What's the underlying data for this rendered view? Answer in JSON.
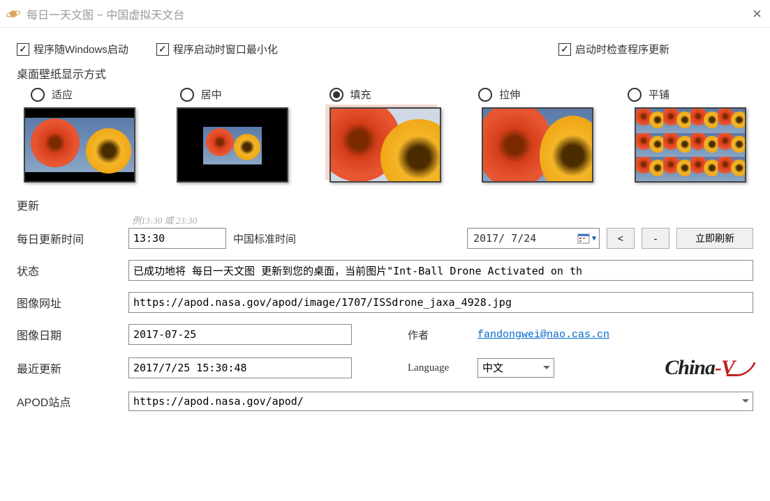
{
  "window": {
    "title": "每日一天文图 ~ 中国虚拟天文台"
  },
  "checkboxes": {
    "startup": {
      "label": "程序随Windows启动",
      "checked": true
    },
    "minimize": {
      "label": "程序启动时窗口最小化",
      "checked": true
    },
    "checkupdate": {
      "label": "启动时检查程序更新",
      "checked": true
    }
  },
  "wallpaper": {
    "heading": "桌面壁纸显示方式",
    "options": {
      "fit": "适应",
      "center": "居中",
      "fill": "填充",
      "stretch": "拉伸",
      "tile": "平铺"
    },
    "selected": "fill"
  },
  "update": {
    "heading": "更新",
    "hint": "例13:30 或 23:30",
    "daily_label": "每日更新时间",
    "daily_value": "13:30",
    "tz_label": "中国标准时间",
    "date_value": "2017/ 7/24",
    "prev_btn": "<",
    "minus_btn": "-",
    "refresh_btn": "立即刷新",
    "status_label": "状态",
    "status_value": "已成功地将 每日一天文图 更新到您的桌面，当前图片\"Int-Ball Drone Activated on th",
    "imgurl_label": "图像网址",
    "imgurl_value": "https://apod.nasa.gov/apod/image/1707/ISSdrone_jaxa_4928.jpg",
    "imgdate_label": "图像日期",
    "imgdate_value": "2017-07-25",
    "author_label": "作者",
    "author_value": "fandongwei@nao.cas.cn",
    "lastupdate_label": "最近更新",
    "lastupdate_value": "2017/7/25 15:30:48",
    "language_label": "Language",
    "language_value": "中文",
    "site_label": "APOD站点",
    "site_value": "https://apod.nasa.gov/apod/"
  },
  "logo": {
    "text1": "China",
    "text2": "-V"
  }
}
